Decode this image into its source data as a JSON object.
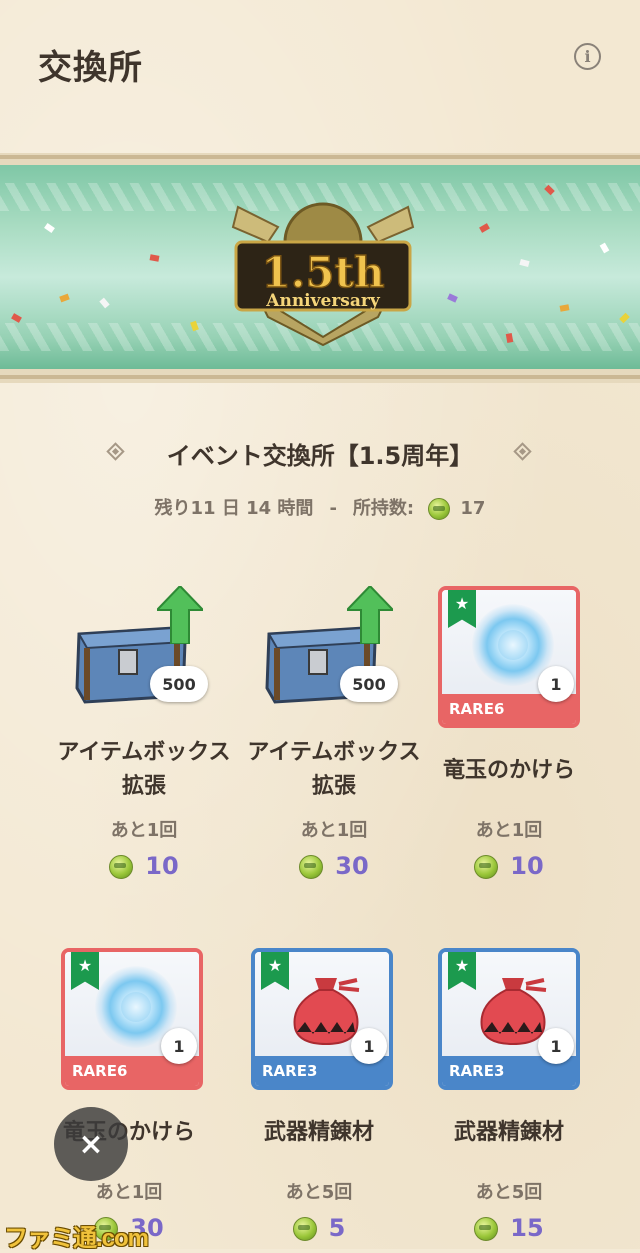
{
  "header": {
    "title": "交換所",
    "info_icon": "info-icon"
  },
  "banner": {
    "emblem_main": "1.5th",
    "emblem_sub": "Anniversary"
  },
  "event": {
    "title": "イベント交換所【1.5周年】",
    "remaining_label": "残り11 日 14 時間",
    "separator": "-",
    "owned_label": "所持数:",
    "owned_count": "17",
    "currency_icon": "anniversary-coin-icon"
  },
  "items": [
    {
      "name": "アイテムボックス拡張",
      "remain": "あと1回",
      "price": "10",
      "qty": "500",
      "rarity": "",
      "kind": "chest"
    },
    {
      "name": "アイテムボックス拡張",
      "remain": "あと1回",
      "price": "30",
      "qty": "500",
      "rarity": "",
      "kind": "chest"
    },
    {
      "name": "竜玉のかけら",
      "remain": "あと1回",
      "price": "10",
      "qty": "1",
      "rarity": "RARE6",
      "kind": "crystal"
    },
    {
      "name": "竜玉のかけら",
      "remain": "あと1回",
      "price": "30",
      "qty": "1",
      "rarity": "RARE6",
      "kind": "crystal"
    },
    {
      "name": "武器精錬材",
      "remain": "あと5回",
      "price": "5",
      "qty": "1",
      "rarity": "RARE3",
      "kind": "bag"
    },
    {
      "name": "武器精錬材",
      "remain": "あと5回",
      "price": "15",
      "qty": "1",
      "rarity": "RARE3",
      "kind": "bag"
    }
  ],
  "close_label": "×",
  "watermark": "ファミ通.com",
  "colors": {
    "rare6": "#e86565",
    "rare3": "#4a86c9",
    "price": "#7a68c8",
    "flag": "#1c9a4e"
  }
}
